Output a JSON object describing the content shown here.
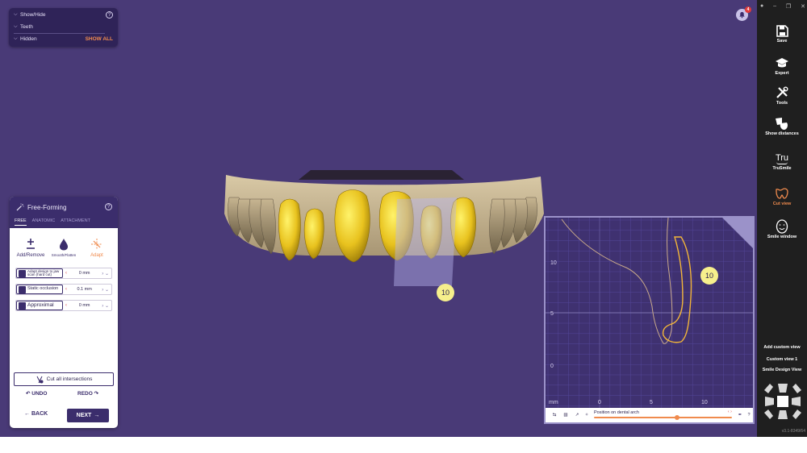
{
  "showhide": {
    "rows": [
      {
        "label": "Show/Hide",
        "action": ""
      },
      {
        "label": "Teeth",
        "action": ""
      },
      {
        "label": "Hidden",
        "action": "SHOW ALL"
      }
    ]
  },
  "notification": {
    "count": "4"
  },
  "freeforming": {
    "title": "Free-Forming",
    "tabs": [
      "FREE",
      "ANATOMIC",
      "ATTACHMENT"
    ],
    "tools": [
      {
        "label": "Add/Remove",
        "icon": "plus-minus-icon"
      },
      {
        "label": "Smooth/Flatten",
        "icon": "drop-icon"
      },
      {
        "label": "Adapt",
        "icon": "adapt-icon"
      }
    ],
    "params": [
      {
        "label": "Adapt design to jaw scan (hard cut)",
        "value": "0 mm"
      },
      {
        "label": "Static occlusion",
        "value": "0.1 mm"
      },
      {
        "label": "Approximal",
        "value": "0 mm"
      }
    ],
    "cut_all": "Cut all intersections",
    "undo": "UNDO",
    "redo": "REDO",
    "back": "BACK",
    "next": "NEXT"
  },
  "tooth_marker": "10",
  "cutview": {
    "marker": "10",
    "unit": "mm",
    "x_ticks": [
      "0",
      "5",
      "10"
    ],
    "y_ticks": [
      "10",
      "5",
      "0"
    ],
    "toolbar_label": "Position on dental arch",
    "slider_position": 0.6,
    "help": "?"
  },
  "rightbar": {
    "items": [
      {
        "label": "Save",
        "icon": "save-icon"
      },
      {
        "label": "Expert",
        "icon": "graduation-cap-icon"
      },
      {
        "label": "Tools",
        "icon": "tools-icon"
      },
      {
        "label": "Show distances",
        "icon": "distances-icon"
      },
      {
        "label": "TruSmile",
        "icon": "trusmile-icon"
      },
      {
        "label": "Cut view",
        "icon": "cut-view-icon"
      },
      {
        "label": "Smile window",
        "icon": "smile-window-icon"
      }
    ],
    "links": [
      "Add custom view",
      "Custom view 1",
      "Smile Design View"
    ],
    "version": "v3.1-8349/64",
    "accent": "#f08b4e"
  },
  "colors": {
    "viewport": "#493a77",
    "panel_dark": "#3b2d6c",
    "tooth_yellow": "#e8c21e",
    "accent_orange": "#f08b4e"
  }
}
